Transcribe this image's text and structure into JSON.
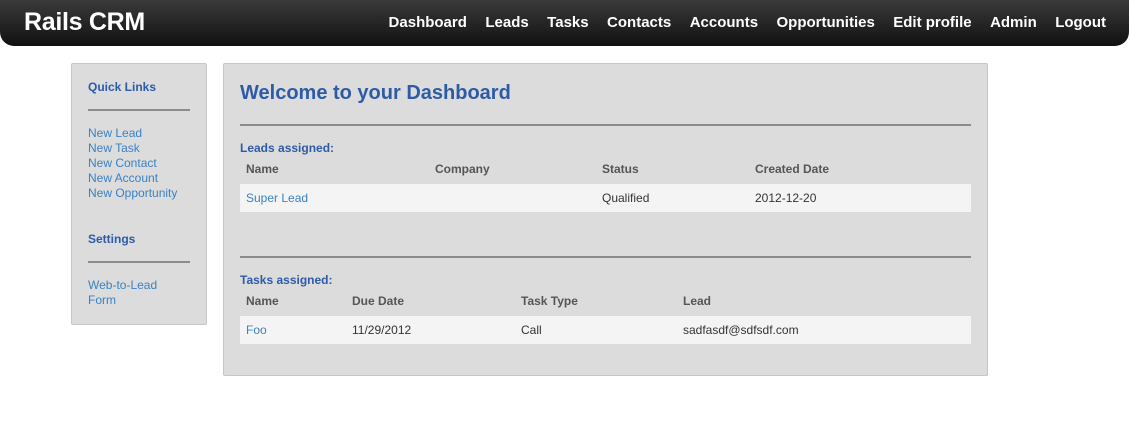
{
  "app": {
    "title": "Rails CRM"
  },
  "nav": {
    "items": [
      "Dashboard",
      "Leads",
      "Tasks",
      "Contacts",
      "Accounts",
      "Opportunities",
      "Edit profile",
      "Admin",
      "Logout"
    ]
  },
  "sidebar": {
    "quick_links_heading": "Quick Links",
    "quick_links": [
      "New Lead",
      "New Task",
      "New Contact",
      "New Account",
      "New Opportunity"
    ],
    "settings_heading": "Settings",
    "settings_links": [
      "Web-to-Lead",
      "Form"
    ]
  },
  "main": {
    "title": "Welcome to your Dashboard",
    "leads": {
      "label": "Leads assigned:",
      "headers": [
        "Name",
        "Company",
        "Status",
        "Created Date"
      ],
      "rows": [
        {
          "name": "Super Lead",
          "company": "",
          "status": "Qualified",
          "created": "2012-12-20"
        }
      ]
    },
    "tasks": {
      "label": "Tasks assigned:",
      "headers": [
        "Name",
        "Due Date",
        "Task Type",
        "Lead"
      ],
      "rows": [
        {
          "name": "Foo",
          "due": "11/29/2012",
          "type": "Call",
          "lead": "sadfasdf@sdfsdf.com"
        }
      ]
    }
  }
}
